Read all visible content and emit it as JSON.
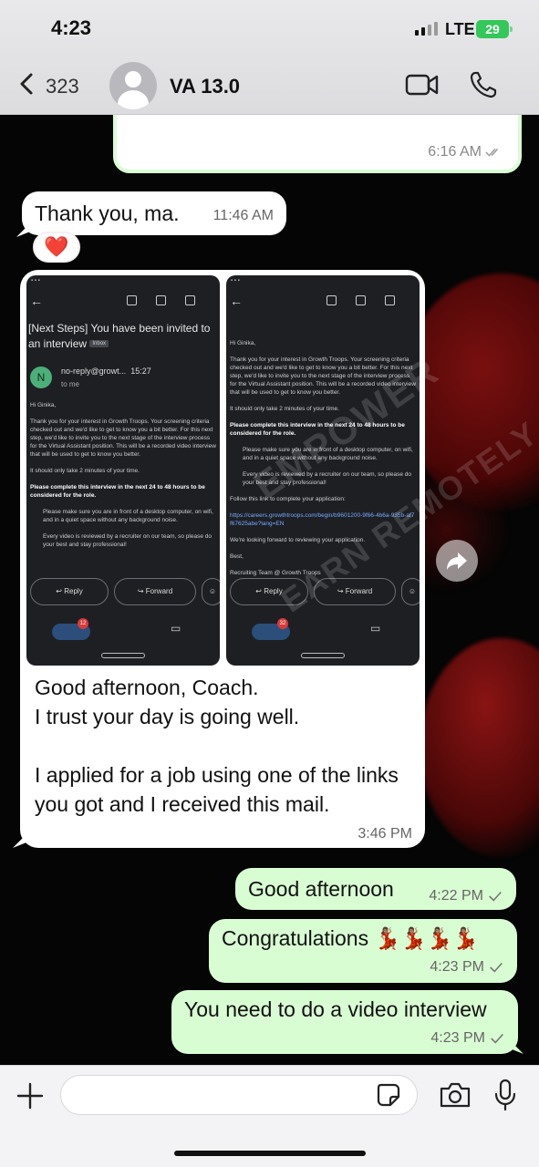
{
  "status_bar": {
    "time": "4:23",
    "network": "LTE",
    "battery": "29"
  },
  "header": {
    "back_count": "323",
    "chat_name": "VA 13.0"
  },
  "messages": {
    "top_partial": {
      "time": "6:16 AM"
    },
    "thanks": {
      "text": "Thank you, ma.",
      "time": "11:46 AM",
      "reaction": "❤️"
    },
    "media": {
      "caption": "Good afternoon, Coach.\nI trust your day is going well.\n\nI applied for a job using one of the links you got and I received this mail.",
      "time": "3:46 PM",
      "shot1": {
        "subject": "[Next Steps] You have been invited to an interview",
        "inbox_tag": "Inbox",
        "sender_initial": "N",
        "sender": "no-reply@growt...",
        "sent_time": "15:27",
        "to_me": "to me",
        "greeting": "Hi Ginika,",
        "para1": "Thank you for your interest in Growth Troops. Your screening criteria checked out and we'd like to get to know you a bit better. For this next step, we'd like to invite you to the next stage of the interview process for the Virtual Assistant position. This will be a recorded video interview that will be used to get to know you better.",
        "para2": "It should only take 2 minutes of your time.",
        "para3": "Please complete this interview in the next 24 to 48 hours to be considered for the role.",
        "bullet1": "Please make sure you are in front of a desktop computer, on wifi, and in a quiet space without any background noise.",
        "bullet2": "Every video is reviewed by a recruiter on our team, so please do your best and stay professional!",
        "reply": "Reply",
        "forward": "Forward",
        "badge": "12"
      },
      "shot2": {
        "greeting": "Hi Ginika,",
        "para1": "Thank you for your interest in Growth Troops. Your screening criteria checked out and we'd like to get to know you a bit better. For this next step, we'd like to invite you to the next stage of the interview process for the Virtual Assistant position. This will be a recorded video interview that will be used to get to know you better.",
        "para2": "It should only take 2 minutes of your time.",
        "para3": "Please complete this interview in the next 24 to 48 hours to be considered for the role.",
        "bullet1": "Please make sure you are in front of a desktop computer, on wifi, and in a quiet space without any background noise.",
        "bullet2": "Every video is reviewed by a recruiter on our team, so please do your best and stay professional!",
        "follow": "Follow this link to complete your application:",
        "link": "https://careers.growthtroops.com/begin/b9601200-9f66-4b6a-935b-af7f67625abe?lang=EN",
        "looking": "We're looking forward to reviewing your application.",
        "best": "Best,",
        "team": "Recruiting Team @ Growth Troops",
        "reply": "Reply",
        "forward": "Forward",
        "badge": "32"
      }
    },
    "good_afternoon": {
      "text": "Good afternoon",
      "time": "4:22 PM"
    },
    "congrats": {
      "text": "Congratulations 💃🏽💃🏽💃🏽💃🏽",
      "time": "4:23 PM"
    },
    "video": {
      "text": "You need to do a video interview",
      "time": "4:23 PM"
    }
  },
  "watermark": {
    "line1": "EMPOWER",
    "line2": "EARN REMOTELY"
  },
  "input": {
    "placeholder": "",
    "value": ""
  },
  "colors": {
    "incoming": "#ffffff",
    "outgoing": "#d9fdd3",
    "header_bg": "#e3e3e6",
    "accent_green": "#34c759"
  }
}
